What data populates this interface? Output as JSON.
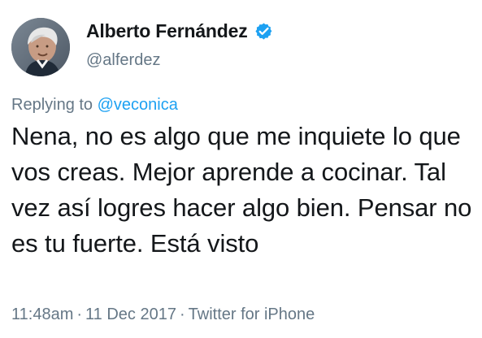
{
  "author": {
    "name": "Alberto Fernández",
    "handle": "@alferdez",
    "avatar_icon": "profile-photo",
    "verified_icon": "verified-badge-icon",
    "verified_color": "#1da1f2"
  },
  "reply": {
    "prefix": "Replying to ",
    "mention": "@veconica"
  },
  "tweet": {
    "text": "Nena, no es algo que me inquiete lo que vos creas. Mejor aprende a cocinar. Tal vez así logres hacer algo bien. Pensar no es tu fuerte. Está visto"
  },
  "meta": {
    "time": "11:48am",
    "separator_1": "·",
    "date": "11 Dec 2017",
    "separator_2": "·",
    "source": "Twitter for iPhone"
  },
  "colors": {
    "text": "#14171a",
    "secondary": "#657786",
    "link": "#1da1f2"
  }
}
